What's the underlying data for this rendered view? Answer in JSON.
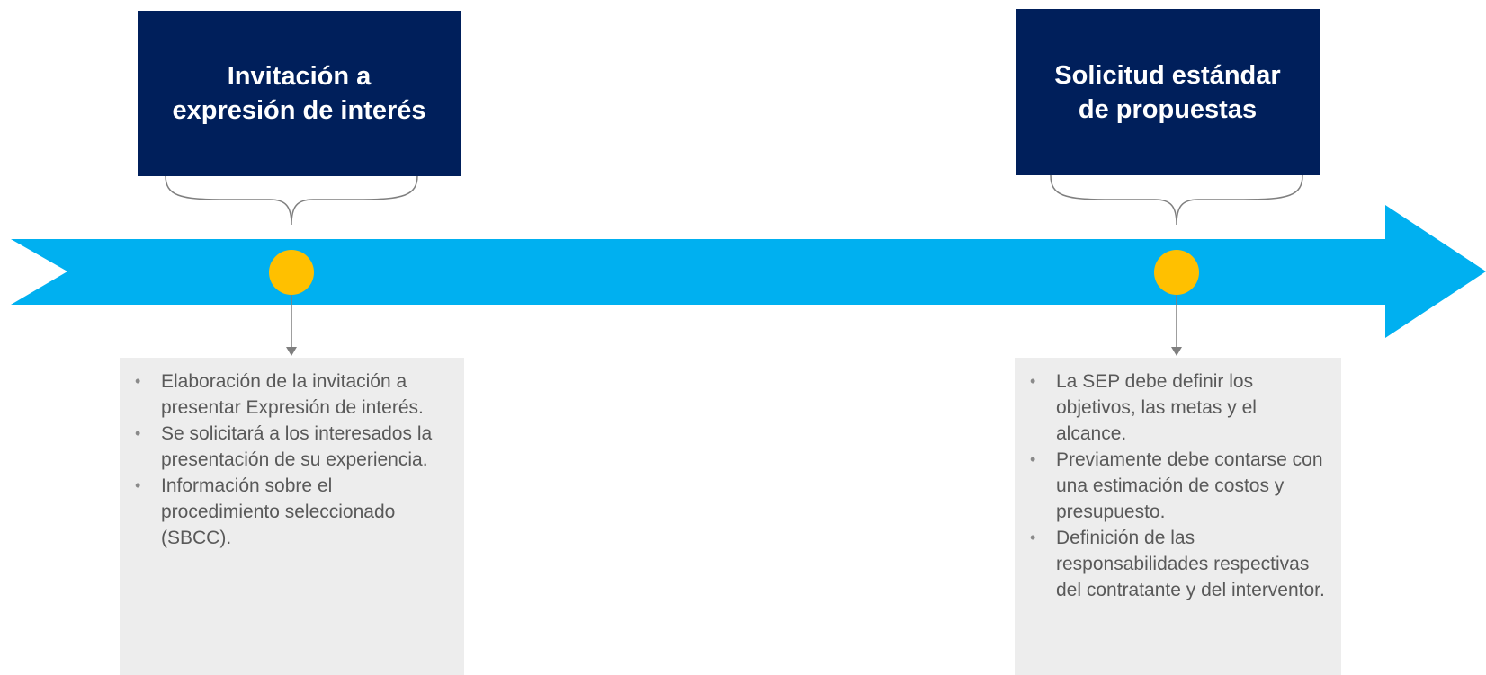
{
  "colors": {
    "arrow": "#00B0F0",
    "marker": "#FFC000",
    "title_background": "#001F5B",
    "title_text": "#FFFFFF",
    "detail_background": "#EDEDED",
    "detail_text": "#595959",
    "connector": "#7F7F7F"
  },
  "milestones": [
    {
      "title": "Invitación a\nexpresión de interés",
      "bullets": [
        "Elaboración de la invitación a presentar Expresión de interés.",
        "Se solicitará a los interesados la presentación de su experiencia.",
        "Información sobre el procedimiento seleccionado (SBCC)."
      ]
    },
    {
      "title": "Solicitud estándar\nde propuestas",
      "bullets": [
        "La SEP debe definir los objetivos, las metas y el alcance.",
        "Previamente debe contarse con una estimación de costos y presupuesto.",
        "Definición de las responsabilidades respectivas del contratante y del interventor."
      ]
    }
  ]
}
